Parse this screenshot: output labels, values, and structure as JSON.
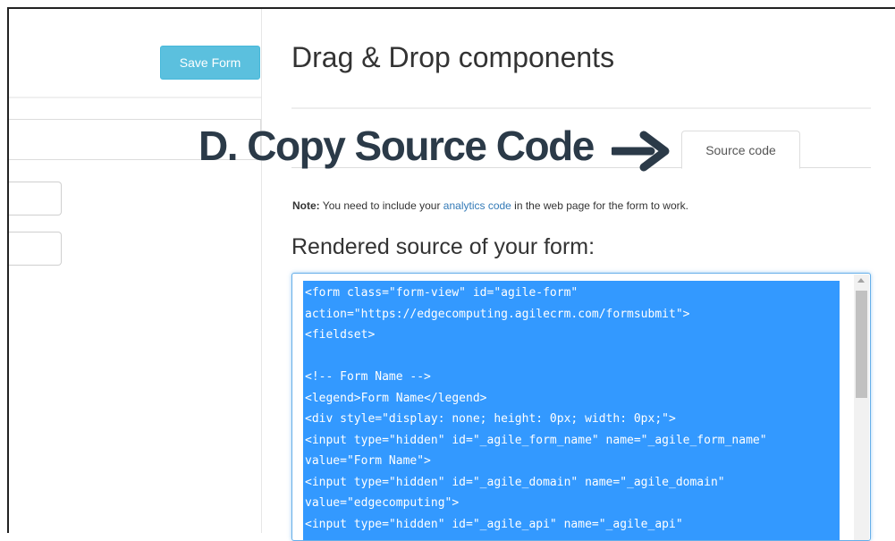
{
  "toolbar": {
    "save_label": "Save Form"
  },
  "header": {
    "title": "Drag & Drop components"
  },
  "overlay": {
    "caption": "D. Copy Source Code",
    "arrow_icon": "right-arrow-icon"
  },
  "tabs": [
    {
      "label": "Source code",
      "active": true
    }
  ],
  "note": {
    "prefix": "Note:",
    "text_before": " You need to include your ",
    "link": "analytics code",
    "text_after": " in the web page for the form to work."
  },
  "source": {
    "title": "Rendered source of your form:",
    "lines": [
      "<form class=\"form-view\" id=\"agile-form\"",
      "action=\"https://edgecomputing.agilecrm.com/formsubmit\">",
      "<fieldset>",
      "",
      "<!-- Form Name -->",
      "<legend>Form Name</legend>",
      "<div style=\"display: none; height: 0px; width: 0px;\">",
      "<input type=\"hidden\" id=\"_agile_form_name\" name=\"_agile_form_name\"",
      "value=\"Form Name\">",
      "<input type=\"hidden\" id=\"_agile_domain\" name=\"_agile_domain\"",
      "value=\"edgecomputing\">",
      "<input type=\"hidden\" id=\"_agile_api\" name=\"_agile_api\""
    ]
  },
  "colors": {
    "save_button": "#5bc0de",
    "caption": "#2b3a48",
    "selection": "#3399ff",
    "link": "#337ab7"
  }
}
